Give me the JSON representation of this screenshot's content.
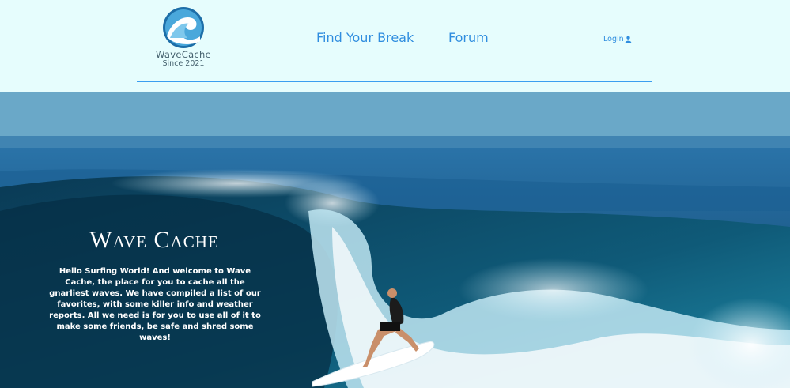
{
  "brand": {
    "name": "WaveCache",
    "tagline": "Since 2021"
  },
  "nav": {
    "find_break": "Find Your Break",
    "forum": "Forum",
    "login": "Login"
  },
  "hero": {
    "title": "Wave Cache",
    "text": "Hello Surfing World! And welcome to Wave Cache, the place for you to cache all the gnarliest waves. We have compiled a list of our favorites, with some killer info and weather reports. All we need is for you to use all of it to make some friends, be safe and shred some waves!"
  },
  "colors": {
    "accent": "#2f8ddf",
    "header_bg": "#e6fdfd",
    "rule": "#3a9ef0"
  },
  "icons": {
    "logo": "wave-logo-icon",
    "login": "user-icon"
  }
}
